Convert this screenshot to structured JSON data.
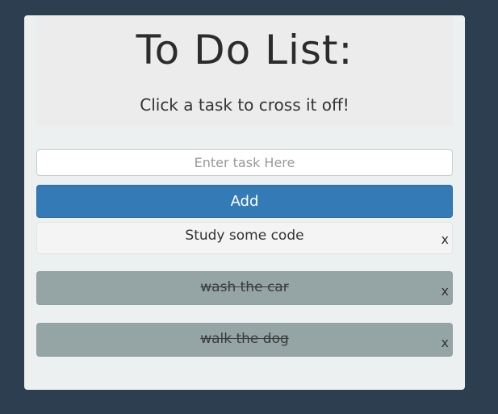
{
  "header": {
    "title": "To Do List:",
    "subtitle": "Click a task to cross it off!"
  },
  "input": {
    "placeholder": "Enter task Here",
    "value": ""
  },
  "add_button": {
    "label": "Add"
  },
  "tasks": [
    {
      "text": "Study some code",
      "completed": false,
      "remove_label": "x"
    },
    {
      "text": "wash the car",
      "completed": true,
      "remove_label": "x"
    },
    {
      "text": "walk the dog",
      "completed": true,
      "remove_label": "x"
    }
  ],
  "colors": {
    "background": "#2c3e50",
    "card": "#ecf0f1",
    "accent": "#337ab7",
    "completed_task": "#95a5a6"
  }
}
